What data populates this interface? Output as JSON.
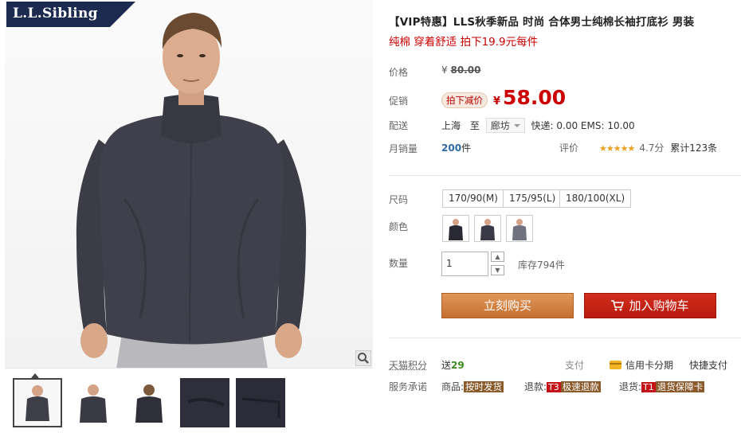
{
  "brand": {
    "logo_text": "L.L.Sibling"
  },
  "product": {
    "title": "【VIP特惠】LLS秋季新品 时尚 合体男士纯棉长袖打底衫 男装",
    "subtitle": "纯棉 穿着舒适 拍下19.9元每件"
  },
  "price": {
    "label": "价格",
    "currency": "¥",
    "original": "80.00",
    "promo_label": "促销",
    "promo_tag": "拍下减价",
    "promo_value": "58.00"
  },
  "shipping": {
    "label": "配送",
    "from": "上海",
    "to_word": "至",
    "destination": "廊坊",
    "fees": "快递: 0.00 EMS: 10.00"
  },
  "sales": {
    "label": "月销量",
    "count": "200",
    "unit": "件",
    "rating_label": "评价",
    "stars": "★★★★★",
    "score": "4.7分",
    "reviews": "累计123条"
  },
  "sku": {
    "size_label": "尺码",
    "sizes": [
      "170/90(M)",
      "175/95(L)",
      "180/100(XL)"
    ],
    "color_label": "颜色",
    "qty_label": "数量",
    "qty_value": "1",
    "stock": "库存794件"
  },
  "actions": {
    "buy_now": "立刻购买",
    "add_cart": "加入购物车"
  },
  "extras": {
    "points_label": "天猫积分",
    "points_prefix": "送",
    "points_value": "29",
    "pay_label": "支付",
    "credit": "信用卡分期",
    "quickpay": "快捷支付",
    "service_label": "服务承诺",
    "svc1_prefix": "商品:",
    "svc1_tag": "按时发货",
    "svc2_prefix": "退款:",
    "svc2_code": "T3",
    "svc2_tag": "极速退款",
    "svc3_prefix": "退货:",
    "svc3_code": "T1",
    "svc3_tag": "退货保障卡"
  },
  "colors": {
    "accent_red": "#c00000",
    "buy_orange": "#d0803f",
    "cart_red": "#c4211a",
    "shirt": "#3e3e48",
    "logo_bg": "#1b2a4e"
  }
}
